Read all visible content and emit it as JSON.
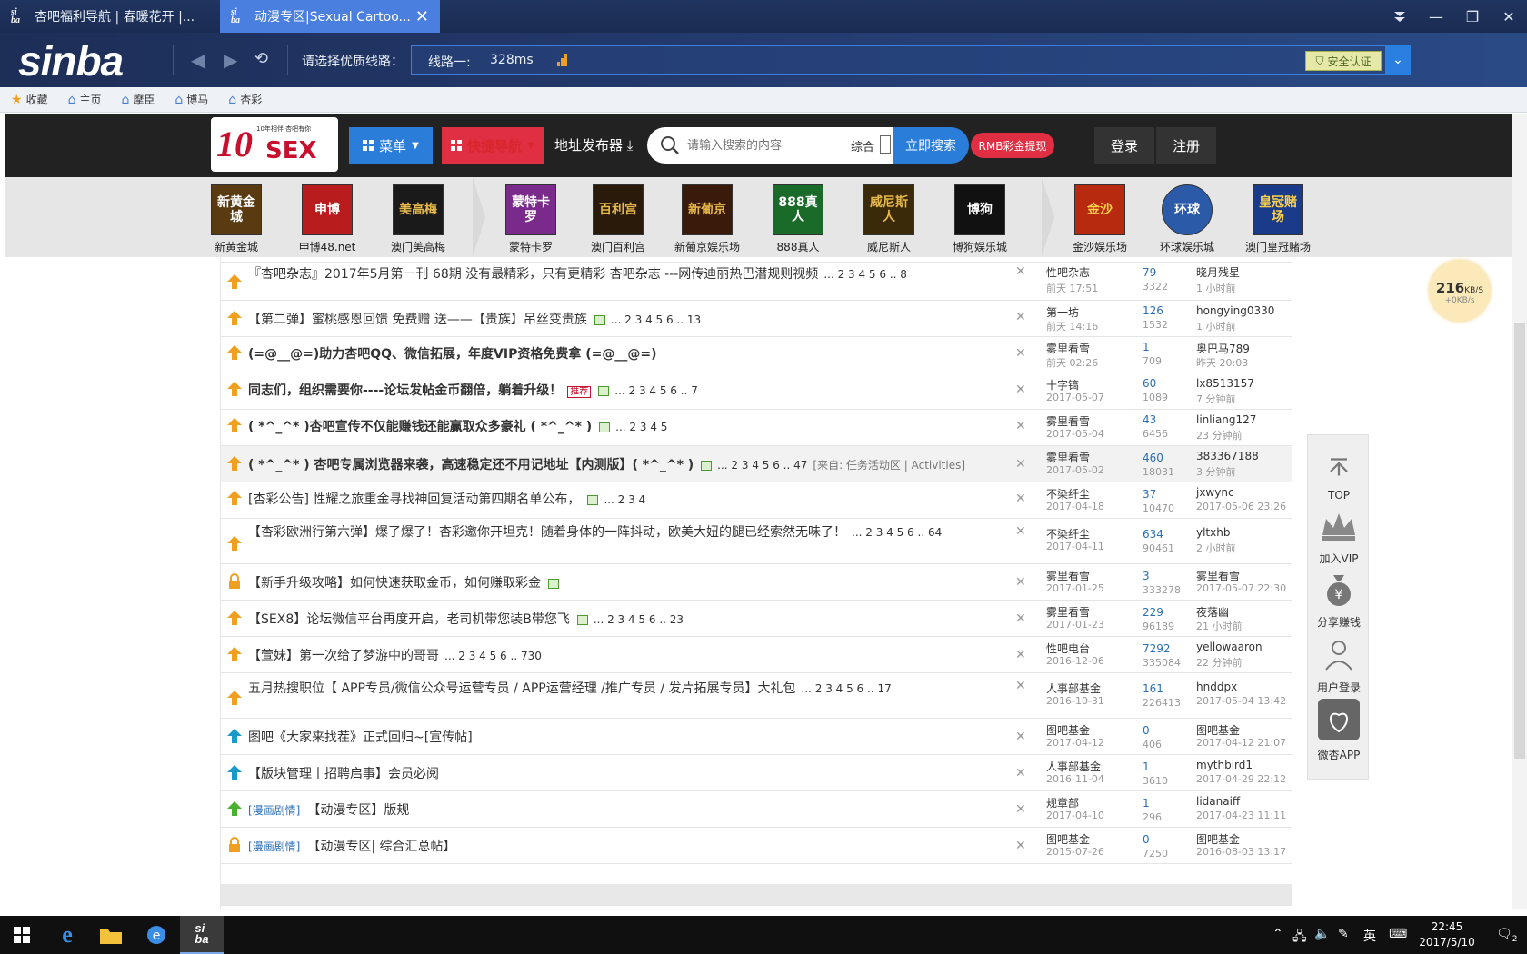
{
  "browser": {
    "tabs": [
      {
        "title": "杏吧福利导航 | 春暖花开 |..."
      },
      {
        "title": "动漫专区|Sexual Cartoo..."
      }
    ],
    "logo": "sinba",
    "line_prompt": "请选择优质线路：",
    "line_name": "线路一:",
    "line_ms": "328ms",
    "secure_label": "安全认证",
    "bookmarks": [
      "收藏",
      "主页",
      "摩臣",
      "博马",
      "杏彩"
    ]
  },
  "site": {
    "logo_big": "10",
    "logo_sex": "SEX",
    "logo_tiny": "10年相伴 杏吧有你",
    "menu_label": "菜单",
    "quicknav_label": "快捷导航",
    "addr_pub_label": "地址发布器",
    "search_placeholder": "请输入搜索的内容",
    "search_category": "综合",
    "search_button": "立即搜索",
    "rmb_button": "RMB彩金提现",
    "login": "登录",
    "register": "注册"
  },
  "casinos": [
    {
      "label": "新黄金城",
      "tile": "新黄金城",
      "color": "#5a3a10"
    },
    {
      "label": "申博48.net",
      "tile": "申博",
      "color": "#b81c1c"
    },
    {
      "label": "澳门美高梅",
      "tile": "美高梅",
      "color": "#1a1a1a"
    },
    {
      "label": "蒙特卡罗",
      "tile": "蒙特卡罗",
      "color": "#7a2a8a"
    },
    {
      "label": "澳门百利宫",
      "tile": "百利宫",
      "color": "#2a1a0a"
    },
    {
      "label": "新葡京娱乐场",
      "tile": "新葡京",
      "color": "#3a1a0a"
    },
    {
      "label": "888真人",
      "tile": "888真人",
      "color": "#1a6a2a"
    },
    {
      "label": "威尼斯人",
      "tile": "威尼斯人",
      "color": "#3a2a0a"
    },
    {
      "label": "博狗娱乐城",
      "tile": "博狗",
      "color": "#111111"
    },
    {
      "label": "金沙娱乐场",
      "tile": "金沙",
      "color": "#b82a10"
    },
    {
      "label": "环球娱乐城",
      "tile": "环球",
      "color": "#2a5aa8"
    },
    {
      "label": "澳门皇冠赌场",
      "tile": "皇冠赌场",
      "color": "#1a3a8a"
    }
  ],
  "threads": [
    {
      "title": "『杏吧杂志』2017年5月第一刊 68期 没有最精彩，只有更精彩 杏吧杂志 ---网传迪丽热巴潜规则视频",
      "pages": "... 2 3 4 5 6 .. 8",
      "author": "性吧杂志",
      "date": "前天 17:51",
      "replies": "79",
      "views": "3322",
      "last_user": "晓月残星",
      "last_time": "1 小时前"
    },
    {
      "title": "【第二弹】蜜桃感恩回馈 免费赠 送——【贵族】吊丝变贵族",
      "pages": "... 2 3 4 5 6 .. 13",
      "author": "第一坊",
      "date": "前天 14:16",
      "replies": "126",
      "views": "1532",
      "last_user": "hongying0330",
      "last_time": "1 小时前"
    },
    {
      "title": "(=@__@=)助力杏吧QQ、微信拓展，年度VIP资格免费拿 (=@__@=)",
      "pages": "",
      "author": "雾里看雪",
      "date": "前天 02:26",
      "replies": "1",
      "views": "709",
      "last_user": "奥巴马789",
      "last_time": "昨天 20:03"
    },
    {
      "title": "同志们，组织需要你----论坛发帖金币翻倍，躺着升级！",
      "tag": "推荐",
      "pages": "... 2 3 4 5 6 .. 7",
      "author": "十字镐",
      "date": "2017-05-07",
      "replies": "60",
      "views": "1089",
      "last_user": "lx8513157",
      "last_time": "7 分钟前"
    },
    {
      "title": "( *^_^* )杏吧宣传不仅能赚钱还能赢取众多豪礼 ( *^_^* )",
      "pages": "... 2 3 4 5",
      "author": "雾里看雪",
      "date": "2017-05-04",
      "replies": "43",
      "views": "6456",
      "last_user": "linliang127",
      "last_time": "23 分钟前"
    },
    {
      "title": "( *^_^* ) 杏吧专属浏览器来袭，高速稳定还不用记地址【内测版】( *^_^* )",
      "pages": "... 2 3 4 5 6 .. 47",
      "source": "[来自: 任务活动区 | Activities]",
      "author": "雾里看雪",
      "date": "2017-05-02",
      "replies": "460",
      "views": "18031",
      "last_user": "383367188",
      "last_time": "3 分钟前"
    },
    {
      "title": "[杏彩公告] 性耀之旅重金寻找神回复活动第四期名单公布，",
      "pages": "... 2 3 4",
      "author": "不染纤尘",
      "date": "2017-04-18",
      "replies": "37",
      "views": "10470",
      "last_user": "jxwync",
      "last_time": "2017-05-06 23:26"
    },
    {
      "title": "【杏彩欧洲行第六弹】爆了爆了！杏彩邀你开坦克！随着身体的一阵抖动，欧美大妞的腿已经索然无味了！",
      "pages": "... 2 3 4 5 6 .. 64",
      "author": "不染纤尘",
      "date": "2017-04-11",
      "replies": "634",
      "views": "90461",
      "last_user": "yltxhb",
      "last_time": "2 小时前"
    },
    {
      "title": "【新手升级攻略】如何快速获取金币，如何赚取彩金",
      "pages": "",
      "author": "雾里看雪",
      "date": "2017-01-25",
      "replies": "3",
      "views": "333278",
      "last_user": "雾里看雪",
      "last_time": "2017-05-07 22:30"
    },
    {
      "title": "【SEX8】论坛微信平台再度开启，老司机带您装B带您飞",
      "pages": "... 2 3 4 5 6 .. 23",
      "author": "雾里看雪",
      "date": "2017-01-23",
      "replies": "229",
      "views": "96189",
      "last_user": "夜落幽",
      "last_time": "21 小时前"
    },
    {
      "title": "【萱妹】第一次给了梦游中的哥哥",
      "pages": "... 2 3 4 5 6 .. 730",
      "author": "性吧电台",
      "date": "2016-12-06",
      "replies": "7292",
      "views": "335084",
      "last_user": "yellowaaron",
      "last_time": "22 分钟前"
    },
    {
      "title": "五月热搜职位【 APP专员/微信公众号运营专员 / APP运营经理 /推广专员 / 发片拓展专员】大礼包",
      "pages": "... 2 3 4 5 6 .. 17",
      "author": "人事部基金",
      "date": "2016-10-31",
      "replies": "161",
      "views": "226413",
      "last_user": "hnddpx",
      "last_time": "2017-05-04 13:42"
    },
    {
      "title": "图吧《大家来找茬》正式回归~[宣传帖]",
      "pages": "",
      "author": "图吧基金",
      "date": "2017-04-12",
      "replies": "0",
      "views": "406",
      "last_user": "图吧基金",
      "last_time": "2017-04-12 21:07"
    },
    {
      "title": "【版块管理丨招聘启事】会员必阅",
      "pages": "",
      "author": "人事部基金",
      "date": "2016-11-04",
      "replies": "1",
      "views": "3610",
      "last_user": "mythbird1",
      "last_time": "2017-04-29 22:12"
    },
    {
      "category": "[漫画剧情]",
      "title": "【动漫专区】版规",
      "pages": "",
      "author": "规章部",
      "date": "2017-04-10",
      "replies": "1",
      "views": "296",
      "last_user": "lidanaiff",
      "last_time": "2017-04-23 11:11"
    },
    {
      "category": "[漫画剧情]",
      "title": "【动漫专区| 综合汇总帖】",
      "pages": "",
      "author": "图吧基金",
      "date": "2015-07-26",
      "replies": "0",
      "views": "7250",
      "last_user": "图吧基金",
      "last_time": "2016-08-03 13:17"
    }
  ],
  "speed": {
    "value": "216",
    "unit": "KB/S",
    "sub": "+0KB/s"
  },
  "sidepanel": [
    "TOP",
    "加入VIP",
    "分享赚钱",
    "用户登录",
    "微杏APP"
  ],
  "taskbar": {
    "ime": "英",
    "time": "22:45",
    "date": "2017/5/10",
    "notif": "2"
  },
  "colors": {
    "accent_blue": "#2a7dd8",
    "accent_red": "#e02f42",
    "thread_red": "#d9262c",
    "thread_green": "#2b9a2b"
  }
}
